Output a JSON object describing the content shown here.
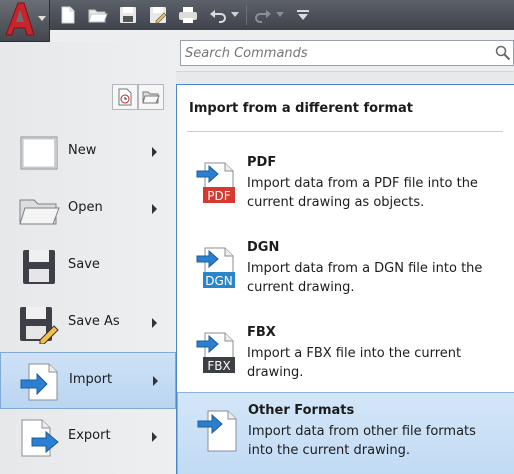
{
  "app": {
    "logo_letter": "A"
  },
  "quick_access": {
    "icons": [
      "new-icon",
      "open-icon",
      "save-icon",
      "save-as-icon",
      "plot-icon",
      "undo-icon",
      "redo-icon",
      "customize-icon"
    ]
  },
  "search": {
    "placeholder": "Search Commands"
  },
  "menu": {
    "items": [
      {
        "label": "New",
        "has_submenu": true
      },
      {
        "label": "Open",
        "has_submenu": true
      },
      {
        "label": "Save",
        "has_submenu": false
      },
      {
        "label": "Save As",
        "has_submenu": true
      },
      {
        "label": "Import",
        "has_submenu": true,
        "active": true
      },
      {
        "label": "Export",
        "has_submenu": true
      }
    ]
  },
  "submenu": {
    "heading": "Import from a different format",
    "items": [
      {
        "title": "PDF",
        "description": "Import data from a PDF file into the current drawing as objects.",
        "icon_text": "PDF",
        "icon_color": "#d8382d"
      },
      {
        "title": "DGN",
        "description": "Import data from a DGN file into the current drawing.",
        "icon_text": "DGN",
        "icon_color": "#2a86c9"
      },
      {
        "title": "FBX",
        "description": "Import a FBX file into the current drawing.",
        "icon_text": "FBX",
        "icon_color": "#3c3f44"
      },
      {
        "title": "Other Formats",
        "description": "Import data from other file formats into the current drawing.",
        "active": true
      }
    ]
  },
  "colors": {
    "accent": "#4d88c6",
    "highlight": "#c1dbf4",
    "toolbar": "#4b4f56",
    "logo_red": "#c8242c"
  }
}
